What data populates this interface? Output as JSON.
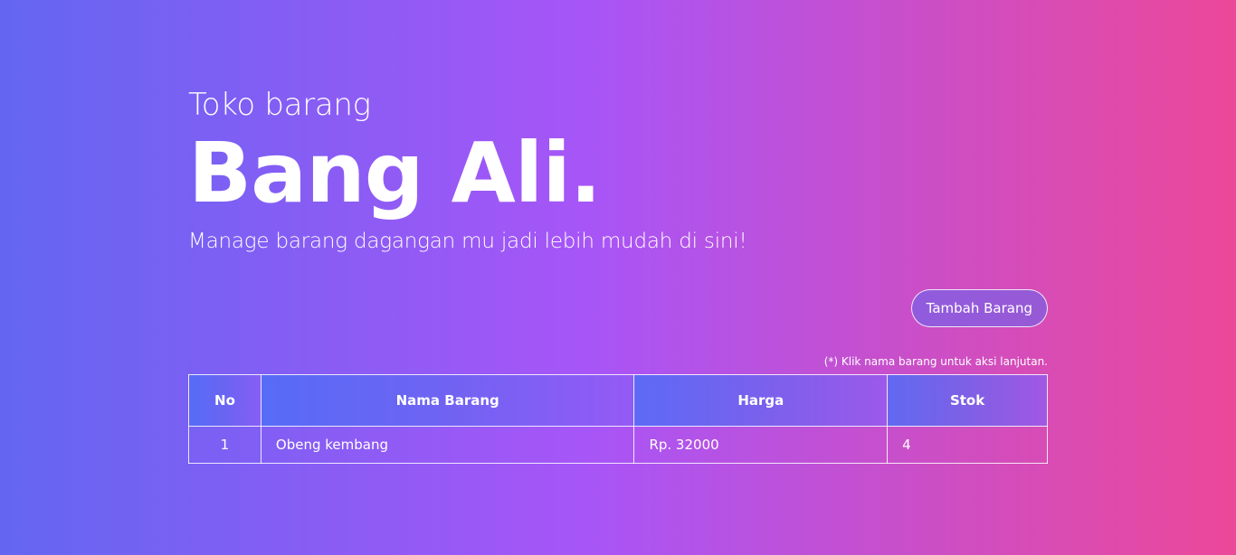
{
  "header": {
    "subtitle_top": "Toko barang",
    "brand": "Bang Ali.",
    "tagline": "Manage barang dagangan mu jadi lebih mudah di sini!"
  },
  "actions": {
    "add_button_label": "Tambah Barang"
  },
  "table": {
    "hint": "(*) Klik nama barang untuk aksi lanjutan.",
    "columns": {
      "no": "No",
      "nama": "Nama Barang",
      "harga": "Harga",
      "stok": "Stok"
    },
    "rows": [
      {
        "no": "1",
        "nama": "Obeng kembang",
        "harga": "Rp. 32000",
        "stok": "4"
      }
    ]
  },
  "colors": {
    "gradient_start": "#6366f1",
    "gradient_mid": "#a855f7",
    "gradient_end": "#ec4899",
    "text": "#ffffff"
  }
}
